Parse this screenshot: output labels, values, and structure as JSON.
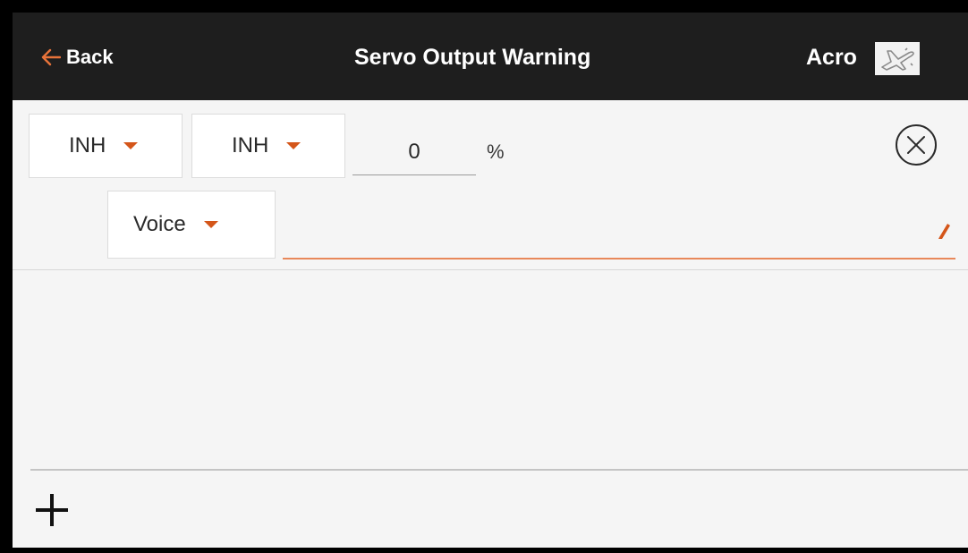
{
  "header": {
    "back_label": "Back",
    "title": "Servo Output Warning",
    "model_type": "Acro",
    "back_icon": "arrow-left-icon",
    "model_icon": "airplane-icon"
  },
  "warning": {
    "source_1": "INH",
    "source_2": "INH",
    "value": "0",
    "unit": "%",
    "alert_type": "Voice",
    "voice_text": "",
    "delete_icon": "close-circle-icon",
    "edit_icon": "pencil-icon"
  },
  "footer": {
    "add_icon": "plus-icon"
  },
  "colors": {
    "header_bg": "#1e1e1e",
    "accent": "#d4561a",
    "background": "#f5f5f5"
  }
}
